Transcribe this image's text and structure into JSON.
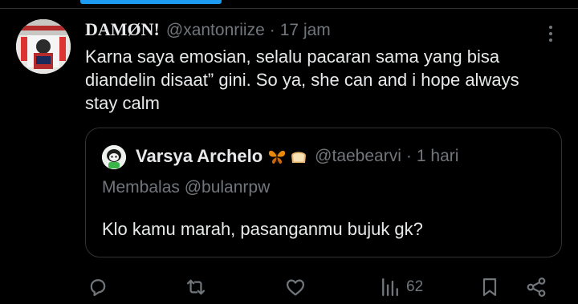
{
  "tweet": {
    "author_name": "DAMØN!",
    "author_handle": "@xantonriize",
    "separator": "·",
    "timestamp": "17 jam",
    "text_lines": [
      "Karna saya emosian, selalu pacaran sama yang bisa",
      "diandelin disaat” gini. So ya, she can and i hope always",
      "stay calm"
    ]
  },
  "quote": {
    "author_name": "Varsya Archelo",
    "emojis": [
      "butterfly-icon",
      "bread-icon"
    ],
    "author_handle": "@taebearvi",
    "separator": "·",
    "timestamp": "1 hari",
    "reply_context": "Membalas @bulanrpw",
    "text": "Klo kamu marah, pasanganmu bujuk gk?"
  },
  "actions": {
    "reply_icon": "reply-icon",
    "retweet_icon": "retweet-icon",
    "like_icon": "heart-icon",
    "views_icon": "views-icon",
    "views_count": "62",
    "bookmark_icon": "bookmark-icon",
    "share_icon": "share-icon"
  },
  "colors": {
    "background": "#000000",
    "text_primary": "#e7e9ea",
    "text_secondary": "#71767b",
    "accent": "#1d9bf0",
    "border": "#2f3336"
  }
}
